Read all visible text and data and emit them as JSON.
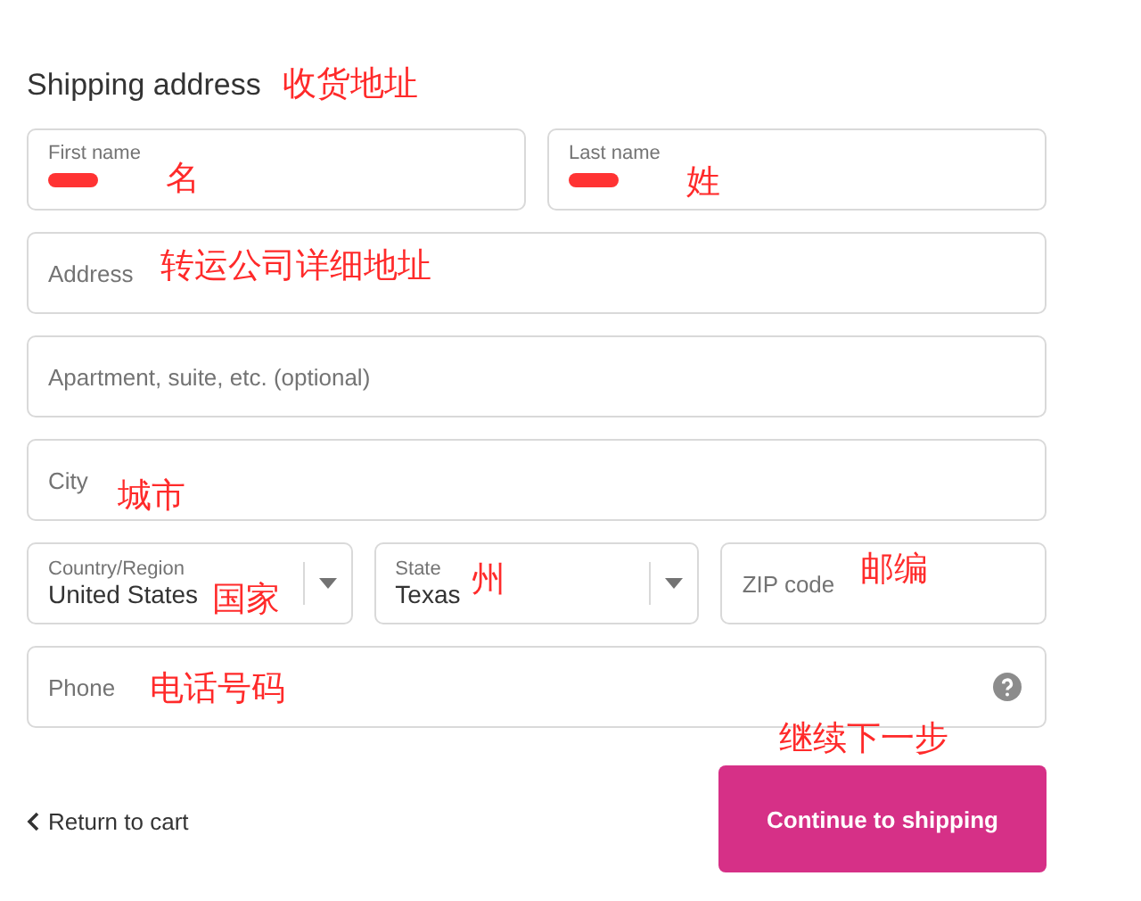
{
  "title": "Shipping address",
  "title_note": "收货地址",
  "rows": [
    [
      {
        "kind": "floating",
        "label": "First name",
        "redacted": true,
        "note": "名"
      },
      {
        "kind": "floating",
        "label": "Last name",
        "redacted": true,
        "note": "姓"
      }
    ],
    [
      {
        "kind": "text",
        "placeholder": "Address",
        "note": "转运公司详细地址"
      }
    ],
    [
      {
        "kind": "text",
        "placeholder": "Apartment, suite, etc. (optional)"
      }
    ],
    [
      {
        "kind": "text",
        "placeholder": "City",
        "note": "城市"
      }
    ],
    [
      {
        "kind": "select",
        "label": "Country/Region",
        "value": "United States",
        "note": "国家"
      },
      {
        "kind": "select",
        "label": "State",
        "value": "Texas",
        "note": "州"
      },
      {
        "kind": "text",
        "placeholder": "ZIP code",
        "note": "邮编"
      }
    ],
    [
      {
        "kind": "text",
        "placeholder": "Phone",
        "help": true,
        "note": "电话号码"
      }
    ]
  ],
  "back_link": "Return to cart",
  "continue_button": "Continue to shipping",
  "continue_note": "继续下一步"
}
